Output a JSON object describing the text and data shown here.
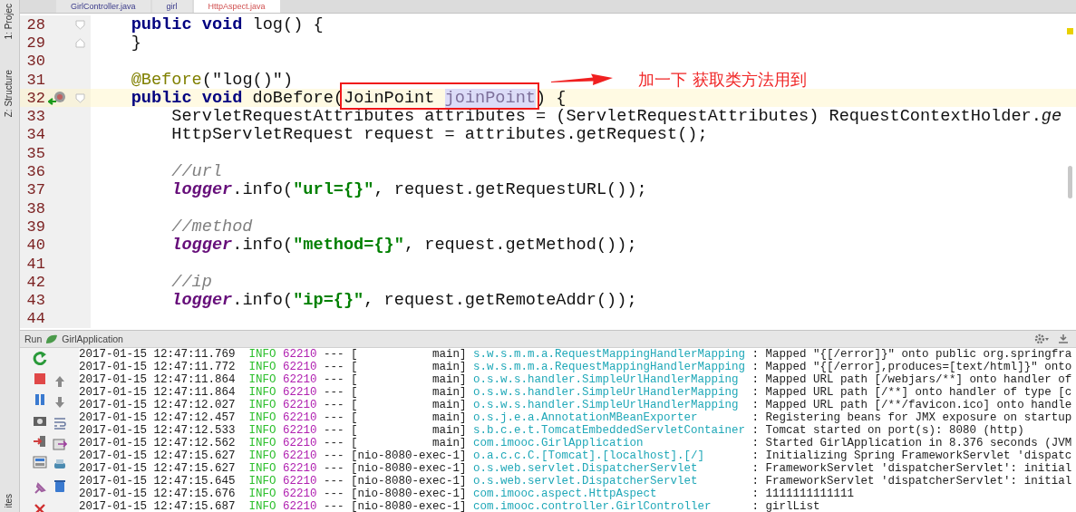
{
  "side_tool_tabs": [
    {
      "label": "1: Projec"
    },
    {
      "label": "Z: Structure"
    },
    {
      "label": "ites"
    }
  ],
  "editor_tabs": [
    {
      "label": "GirlController.java",
      "selected": false
    },
    {
      "label": "girl",
      "selected": false
    },
    {
      "label": "HttpAspect.java",
      "selected": true
    }
  ],
  "editor": {
    "lines": [
      {
        "number": "28",
        "current": false,
        "fold_marker": {
          "kind": "start"
        },
        "tokens": [
          {
            "kind": "keyword",
            "text": "    public void"
          },
          {
            "kind": "plain",
            "text": " log() {"
          }
        ]
      },
      {
        "number": "29",
        "current": false,
        "fold_marker": {
          "kind": "end"
        },
        "tokens": [
          {
            "kind": "plain",
            "text": "    }"
          }
        ]
      },
      {
        "number": "30",
        "current": false
      },
      {
        "number": "31",
        "current": false,
        "tokens": [
          {
            "kind": "annotation",
            "text": "    @Before"
          },
          {
            "kind": "plain",
            "text": "(\"log()\")"
          }
        ],
        "callout": {
          "text": "加一下  获取类方法用到"
        }
      },
      {
        "number": "32",
        "current": true,
        "fold_marker": {
          "kind": "start"
        },
        "gutter_marker": {
          "kind": "override"
        },
        "tokens": [
          {
            "kind": "keyword",
            "text": "    public void"
          },
          {
            "kind": "plain",
            "text": " doBefore("
          },
          {
            "kind": "plain",
            "text": "JoinPoint ",
            "boxed": true
          },
          {
            "kind": "param",
            "text": "joinPoint",
            "boxed": true
          },
          {
            "kind": "plain",
            "text": ") {"
          }
        ]
      },
      {
        "number": "33",
        "current": false,
        "tokens": [
          {
            "kind": "plain",
            "text": "        ServletRequestAttributes attributes = (ServletRequestAttributes) RequestContextHolder."
          },
          {
            "kind": "static",
            "text": "ge"
          }
        ]
      },
      {
        "number": "34",
        "current": false,
        "tokens": [
          {
            "kind": "plain",
            "text": "        HttpServletRequest request = attributes.getRequest();"
          }
        ]
      },
      {
        "number": "35",
        "current": false
      },
      {
        "number": "36",
        "current": false,
        "tokens": [
          {
            "kind": "comment",
            "text": "        //url"
          }
        ]
      },
      {
        "number": "37",
        "current": false,
        "tokens": [
          {
            "kind": "field",
            "text": "        logger"
          },
          {
            "kind": "plain",
            "text": ".info("
          },
          {
            "kind": "string",
            "text": "\"url={}\""
          },
          {
            "kind": "plain",
            "text": ", request.getRequestURL());"
          }
        ]
      },
      {
        "number": "38",
        "current": false
      },
      {
        "number": "39",
        "current": false,
        "tokens": [
          {
            "kind": "comment",
            "text": "        //method"
          }
        ]
      },
      {
        "number": "40",
        "current": false,
        "tokens": [
          {
            "kind": "field",
            "text": "        logger"
          },
          {
            "kind": "plain",
            "text": ".info("
          },
          {
            "kind": "string",
            "text": "\"method={}\""
          },
          {
            "kind": "plain",
            "text": ", request.getMethod());"
          }
        ]
      },
      {
        "number": "41",
        "current": false
      },
      {
        "number": "42",
        "current": false,
        "tokens": [
          {
            "kind": "comment",
            "text": "        //ip"
          }
        ]
      },
      {
        "number": "43",
        "current": false,
        "tokens": [
          {
            "kind": "field",
            "text": "        logger"
          },
          {
            "kind": "plain",
            "text": ".info("
          },
          {
            "kind": "string",
            "text": "\"ip={}\""
          },
          {
            "kind": "plain",
            "text": ", request.getRemoteAddr());"
          }
        ]
      },
      {
        "number": "44",
        "current": false
      }
    ]
  },
  "run_panel": {
    "title": "Run",
    "config": "GirlApplication",
    "logs": [
      {
        "time": "2017-01-15 12:47:11.769",
        "level": "INFO",
        "pid": "62210",
        "sep": "---",
        "thread": "[           main]",
        "logger": "s.w.s.m.m.a.RequestMappingHandlerMapping",
        "message": ": Mapped \"{[/error]}\" onto public org.springfra"
      },
      {
        "time": "2017-01-15 12:47:11.772",
        "level": "INFO",
        "pid": "62210",
        "sep": "---",
        "thread": "[           main]",
        "logger": "s.w.s.m.m.a.RequestMappingHandlerMapping",
        "message": ": Mapped \"{[/error],produces=[text/html]}\" onto"
      },
      {
        "time": "2017-01-15 12:47:11.864",
        "level": "INFO",
        "pid": "62210",
        "sep": "---",
        "thread": "[           main]",
        "logger": "o.s.w.s.handler.SimpleUrlHandlerMapping",
        "message": ": Mapped URL path [/webjars/**] onto handler of"
      },
      {
        "time": "2017-01-15 12:47:11.864",
        "level": "INFO",
        "pid": "62210",
        "sep": "---",
        "thread": "[           main]",
        "logger": "o.s.w.s.handler.SimpleUrlHandlerMapping",
        "message": ": Mapped URL path [/**] onto handler of type [c"
      },
      {
        "time": "2017-01-15 12:47:12.027",
        "level": "INFO",
        "pid": "62210",
        "sep": "---",
        "thread": "[           main]",
        "logger": "o.s.w.s.handler.SimpleUrlHandlerMapping",
        "message": ": Mapped URL path [/**/favicon.ico] onto handle"
      },
      {
        "time": "2017-01-15 12:47:12.457",
        "level": "INFO",
        "pid": "62210",
        "sep": "---",
        "thread": "[           main]",
        "logger": "o.s.j.e.a.AnnotationMBeanExporter",
        "message": ": Registering beans for JMX exposure on startup"
      },
      {
        "time": "2017-01-15 12:47:12.533",
        "level": "INFO",
        "pid": "62210",
        "sep": "---",
        "thread": "[           main]",
        "logger": "s.b.c.e.t.TomcatEmbeddedServletContainer",
        "message": ": Tomcat started on port(s): 8080 (http)"
      },
      {
        "time": "2017-01-15 12:47:12.562",
        "level": "INFO",
        "pid": "62210",
        "sep": "---",
        "thread": "[           main]",
        "logger": "com.imooc.GirlApplication",
        "message": ": Started GirlApplication in 8.376 seconds (JVM"
      },
      {
        "time": "2017-01-15 12:47:15.627",
        "level": "INFO",
        "pid": "62210",
        "sep": "---",
        "thread": "[nio-8080-exec-1]",
        "logger": "o.a.c.c.C.[Tomcat].[localhost].[/]",
        "message": ": Initializing Spring FrameworkServlet 'dispatc"
      },
      {
        "time": "2017-01-15 12:47:15.627",
        "level": "INFO",
        "pid": "62210",
        "sep": "---",
        "thread": "[nio-8080-exec-1]",
        "logger": "o.s.web.servlet.DispatcherServlet",
        "message": ": FrameworkServlet 'dispatcherServlet': initial"
      },
      {
        "time": "2017-01-15 12:47:15.645",
        "level": "INFO",
        "pid": "62210",
        "sep": "---",
        "thread": "[nio-8080-exec-1]",
        "logger": "o.s.web.servlet.DispatcherServlet",
        "message": ": FrameworkServlet 'dispatcherServlet': initial"
      },
      {
        "time": "2017-01-15 12:47:15.676",
        "level": "INFO",
        "pid": "62210",
        "sep": "---",
        "thread": "[nio-8080-exec-1]",
        "logger": "com.imooc.aspect.HttpAspect",
        "message": ": 1111111111111"
      },
      {
        "time": "2017-01-15 12:47:15.687",
        "level": "INFO",
        "pid": "62210",
        "sep": "---",
        "thread": "[nio-8080-exec-1]",
        "logger": "com.imooc.controller.GirlController",
        "message": ": girlList"
      }
    ]
  }
}
